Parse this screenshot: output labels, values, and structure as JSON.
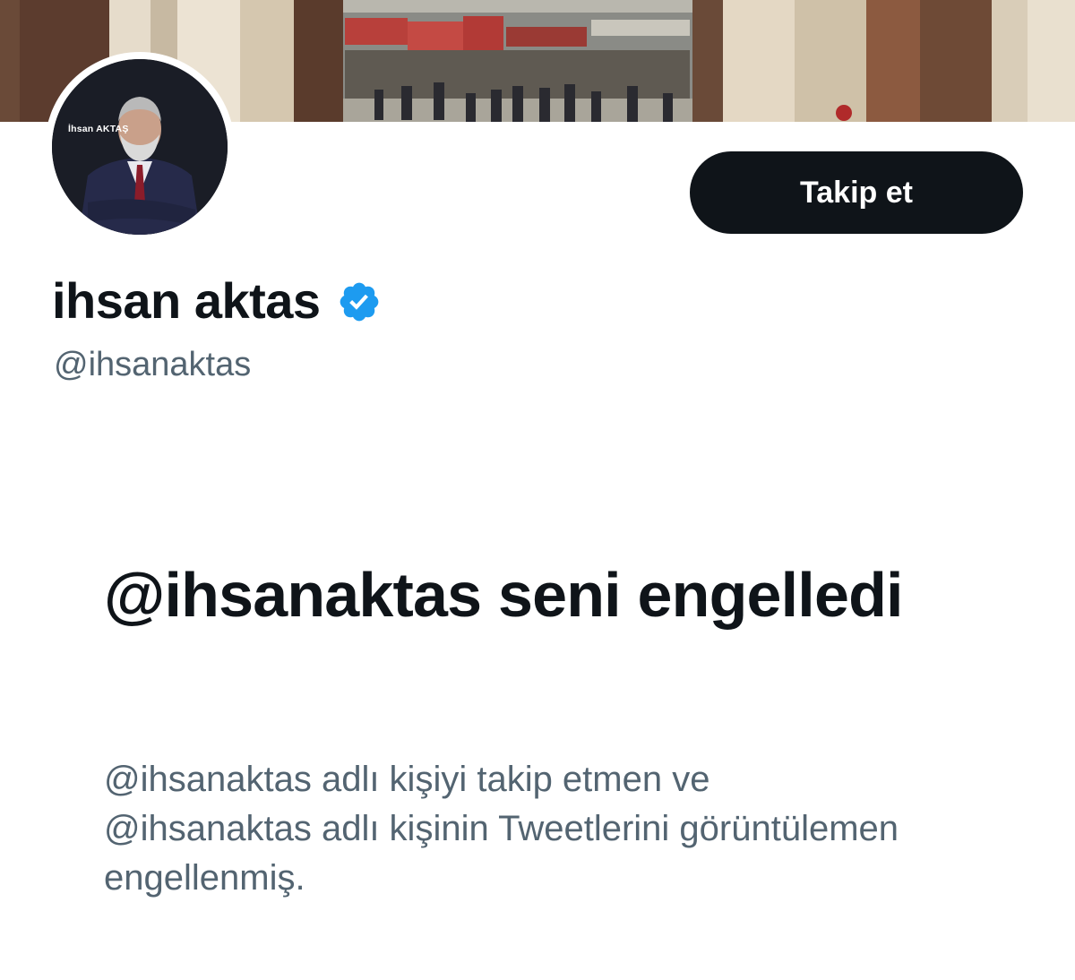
{
  "profile": {
    "display_name": "ihsan aktas",
    "handle": "@ihsanaktas",
    "verified_icon": "verified-badge-icon",
    "avatar_caption": "İhsan AKTAŞ",
    "follow_label": "Takip et"
  },
  "blocked": {
    "title": "@ihsanaktas seni engelledi",
    "description": "@ihsanaktas adlı kişiyi takip etmen ve @ihsanaktas adlı kişinin Tweetlerini görüntülemen engellenmiş."
  },
  "colors": {
    "primary_text": "#0f1419",
    "secondary_text": "#536471",
    "verified_blue": "#1d9bf0",
    "button_bg": "#0f1419",
    "button_text": "#ffffff"
  }
}
